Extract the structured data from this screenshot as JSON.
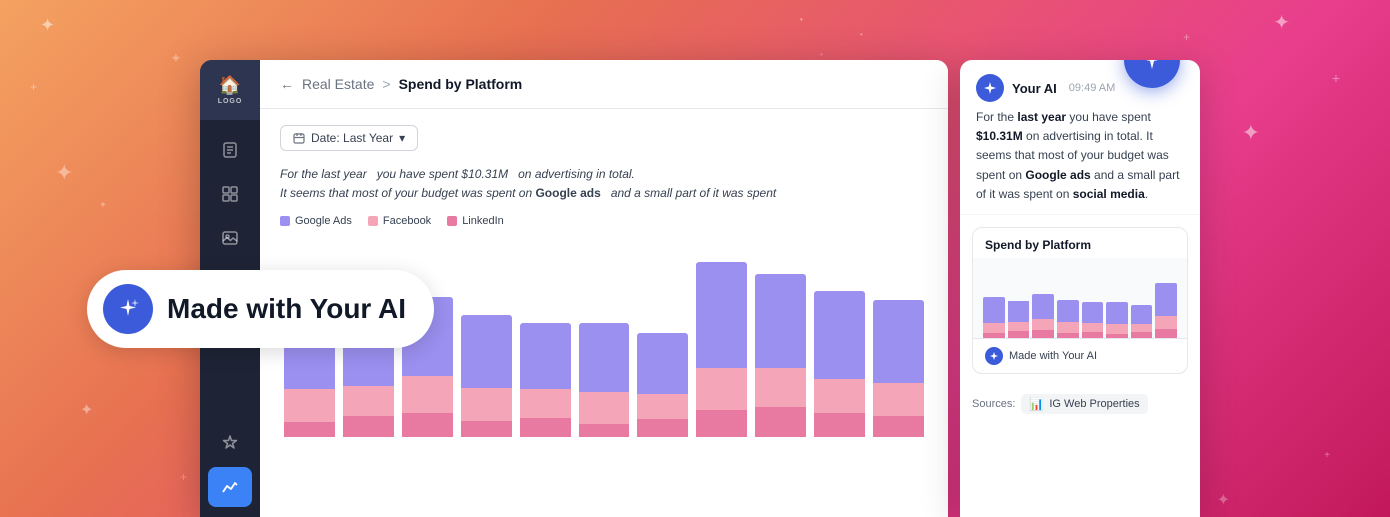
{
  "background": {
    "gradient_start": "#f4a261",
    "gradient_end": "#c2185b"
  },
  "sidebar": {
    "logo_text": "LOGO",
    "items": [
      {
        "id": "home",
        "icon": "🏠",
        "active": true
      },
      {
        "id": "docs",
        "icon": "📄",
        "active": false
      },
      {
        "id": "grid",
        "icon": "⊞",
        "active": false
      },
      {
        "id": "image",
        "icon": "🖼",
        "active": false
      },
      {
        "id": "star",
        "icon": "☆",
        "active": false
      },
      {
        "id": "chart",
        "icon": "📈",
        "active": true
      }
    ]
  },
  "breadcrumb": {
    "back": "←",
    "parent": "Real Estate",
    "separator": ">",
    "current": "Spend by Platform"
  },
  "filter": {
    "label": "Date: Last Year",
    "icon": "📅"
  },
  "insight": {
    "line1": "For the last year  you have spent $10.31M  on advertising in total.",
    "line2": "It seems that most of your budget was spent on Google ads  and a small part of it was spent"
  },
  "legend": {
    "items": [
      {
        "label": "Google Ads",
        "color": "#9b8fef"
      },
      {
        "label": "Facebook",
        "color": "#f5a5b8"
      },
      {
        "label": "LinkedIn",
        "color": "#e879a0"
      }
    ]
  },
  "chart": {
    "bars": [
      {
        "google": 55,
        "facebook": 22,
        "linkedin": 10
      },
      {
        "google": 45,
        "facebook": 20,
        "linkedin": 14
      },
      {
        "google": 52,
        "facebook": 25,
        "linkedin": 16
      },
      {
        "google": 48,
        "facebook": 22,
        "linkedin": 11
      },
      {
        "google": 44,
        "facebook": 19,
        "linkedin": 13
      },
      {
        "google": 46,
        "facebook": 21,
        "linkedin": 9
      },
      {
        "google": 40,
        "facebook": 17,
        "linkedin": 12
      },
      {
        "google": 70,
        "facebook": 28,
        "linkedin": 18
      },
      {
        "google": 62,
        "facebook": 26,
        "linkedin": 20
      },
      {
        "google": 58,
        "facebook": 23,
        "linkedin": 16
      },
      {
        "google": 55,
        "facebook": 22,
        "linkedin": 14
      }
    ],
    "colors": {
      "google": "#9b8fef",
      "facebook": "#f5a5b8",
      "linkedin": "#e879a0"
    }
  },
  "ai_panel": {
    "author": "Your AI",
    "time": "09:49 AM",
    "avatar_icon": "✦",
    "message": {
      "part1": "For the ",
      "bold1": "last year",
      "part2": " you have spent ",
      "bold2": "$10.31M",
      "part3": " on advertising in total. It seems that most of your budget was spent on ",
      "bold3": "Google ads",
      "part4": " and a small part of it was spent on ",
      "bold4": "social media",
      "part5": "."
    },
    "mini_chart": {
      "title": "Spend by Platform",
      "footer_icon": "✦",
      "footer_text": "Made with Your AI"
    },
    "sources_label": "Sources:",
    "source_badge": "IG Web Properties",
    "source_icon": "📊"
  },
  "made_with_ai": {
    "icon": "✦",
    "text": "Made with Your AI"
  }
}
